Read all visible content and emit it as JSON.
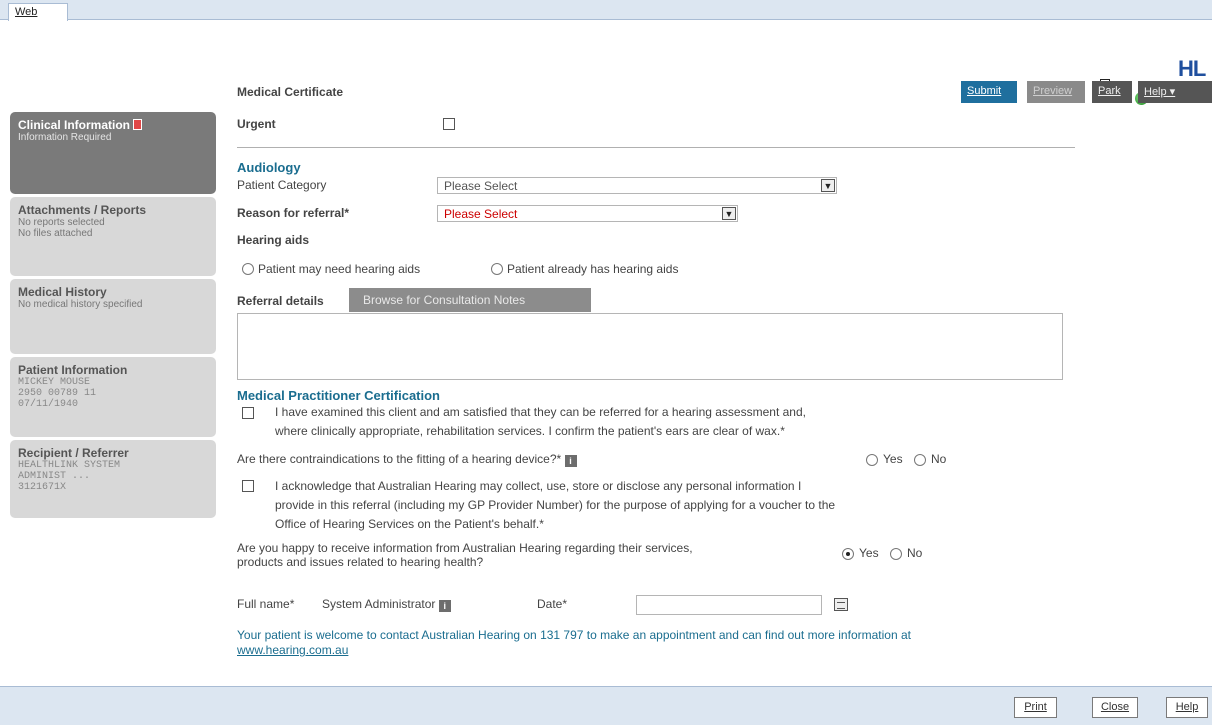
{
  "window": {
    "tab": "Web",
    "logo": "HL"
  },
  "header": {
    "title": "Medical Certificate",
    "actions": {
      "submit": "Submit",
      "preview": "Preview",
      "park": "Park",
      "help": "Help ▾"
    }
  },
  "sidebar": {
    "clinical": {
      "title": "Clinical Information",
      "sub": "Information Required"
    },
    "attachments": {
      "title": "Attachments / Reports",
      "lines": [
        "No reports selected",
        "No files attached"
      ]
    },
    "history": {
      "title": "Medical History",
      "lines": [
        "No medical history specified"
      ]
    },
    "patient": {
      "title": "Patient Information",
      "lines": [
        "MICKEY MOUSE",
        "2950 00789 11",
        "07/11/1940"
      ]
    },
    "recipient": {
      "title": "Recipient / Referrer",
      "lines": [
        "HEALTHLINK SYSTEM",
        "ADMINIST ...",
        "3121671X"
      ]
    }
  },
  "form": {
    "urgent_label": "Urgent",
    "audiology_title": "Audiology",
    "patient_category_label": "Patient Category",
    "patient_category_value": "Please Select",
    "reason_label": "Reason for referral*",
    "reason_value": "Please Select",
    "hearing_aids_label": "Hearing aids",
    "hearing_aid_option_1": "Patient may need hearing aids",
    "hearing_aid_option_2": "Patient already has hearing aids",
    "referral_details_label": "Referral details",
    "browse_button": "Browse for Consultation Notes",
    "certification_title": "Medical Practitioner Certification",
    "cert_line_1": "I have examined this client and am satisfied that they can be referred for a hearing assessment and,",
    "cert_line_2": "where clinically appropriate, rehabilitation services. I confirm the patient's ears are clear of wax.*",
    "contra_question": "Are there contraindications to the fitting of a hearing device?*",
    "yes": "Yes",
    "no": "No",
    "ack_line_1": "I acknowledge that Australian Hearing may collect, use, store or disclose any personal information I",
    "ack_line_2": "provide in this referral (including my GP Provider Number) for the purpose of applying for a voucher to the",
    "ack_line_3": "Office of Hearing Services on the Patient's behalf.*",
    "happy_line_1": "Are you happy to receive information from Australian Hearing regarding their services,",
    "happy_line_2": "products and issues related to hearing health?",
    "full_name_label": "Full name*",
    "full_name_value": "System Administrator",
    "date_label": "Date*",
    "footer_text": "Your patient is welcome to contact Australian Hearing on 131 797 to make an appointment and can find out more information at",
    "footer_link": "www.hearing.com.au"
  },
  "bottom": {
    "print": "Print",
    "close": "Close",
    "help": "Help"
  },
  "colors": {
    "accent": "#1f6f9e",
    "section": "#1a6d8f",
    "required_red": "#cc0000"
  }
}
